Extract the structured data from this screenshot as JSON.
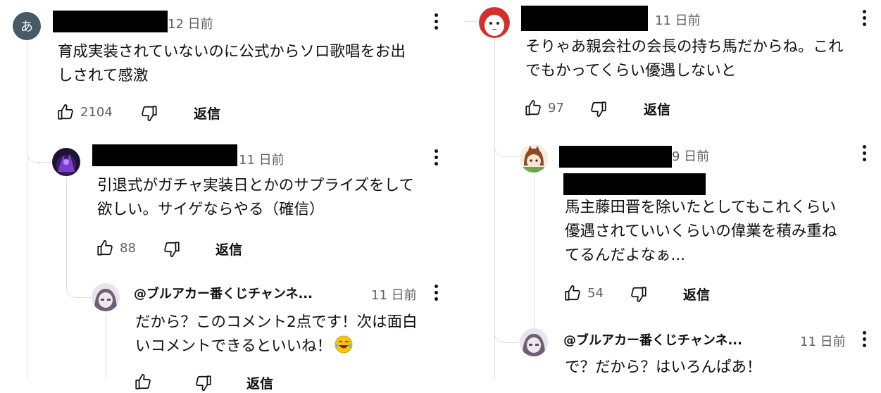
{
  "comments": {
    "c1": {
      "avatar_letter": "あ",
      "time": "12 日前",
      "lines": [
        "育成実装されていないのに公式からソロ歌唱をお出",
        "しされて感激"
      ],
      "likes": "2104",
      "reply_label": "返信"
    },
    "c2": {
      "time": "11 日前",
      "lines": [
        "引退式がガチャ実装日とかのサプライズをして",
        "欲しい。サイゲならやる（確信）"
      ],
      "likes": "88",
      "reply_label": "返信"
    },
    "c3": {
      "author": "@ブルアカー番くじチャンネ...",
      "time": "11 日前",
      "lines": [
        "だから？このコメント2点です！次は面白",
        "いコメントできるといいね！"
      ],
      "emoji": "laugh-cry",
      "reply_label": "返信"
    },
    "c4": {
      "time": "11 日前",
      "lines": [
        "そりゃあ親会社の会長の持ち馬だからね。これ",
        "でもかってくらい優遇しないと"
      ],
      "likes": "97",
      "reply_label": "返信"
    },
    "c5": {
      "time": "9 日前",
      "lines": [
        "馬主藤田晋を除いたとしてもこれくらい",
        "優遇されていいくらいの偉業を積み重ね",
        "てるんだよなぁ..."
      ],
      "likes": "54",
      "reply_label": "返信"
    },
    "c6": {
      "author": "@ブルアカー番くじチャンネ...",
      "time": "11 日前",
      "lines": [
        "で？だから？はいろんぱあ！"
      ]
    }
  },
  "icons": {
    "like": "thumbs-up-icon",
    "dislike": "thumbs-down-icon",
    "menu": "more-vert-icon"
  },
  "colors": {
    "text": "#0f0f0f",
    "secondary": "#606060",
    "thread_line": "#e0e0e0",
    "avatar_letter_bg": "#455a64"
  }
}
